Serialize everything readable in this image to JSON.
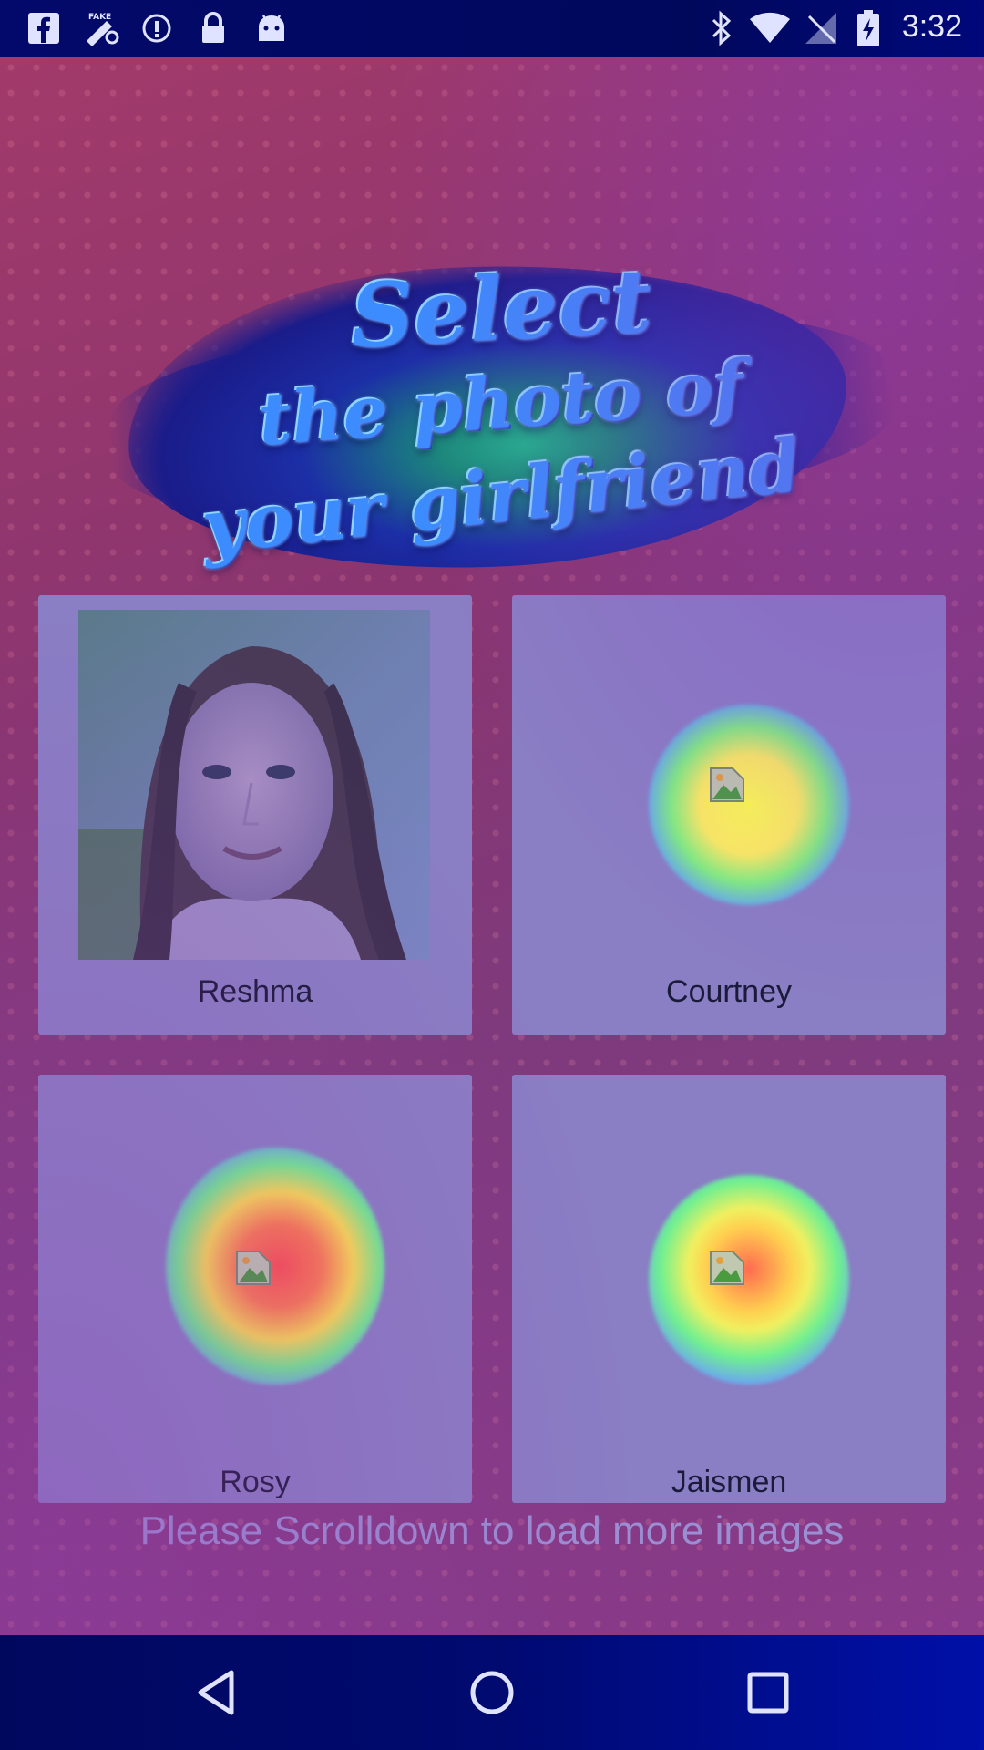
{
  "status_bar": {
    "time": "3:32",
    "left_icons": [
      "facebook-icon",
      "fake-gps-icon",
      "info-icon",
      "lock-icon",
      "android-icon"
    ],
    "right_icons": [
      "bluetooth-icon",
      "wifi-icon",
      "no-signal-icon",
      "battery-charging-icon"
    ]
  },
  "banner": {
    "line1": "Select",
    "line2": "the photo of",
    "line3": "your girlfriend"
  },
  "cards": [
    {
      "name": "Reshma",
      "has_photo": true
    },
    {
      "name": "Courtney",
      "has_photo": false
    },
    {
      "name": "Rosy",
      "has_photo": false
    },
    {
      "name": "Jaismen",
      "has_photo": false
    }
  ],
  "scroll_hint": "Please Scrolldown to load more images",
  "nav_bar": {
    "buttons": [
      "back-icon",
      "home-icon",
      "recents-icon"
    ]
  },
  "colors": {
    "card_background": "#8a7ec4",
    "title_blue": "#3c8cff",
    "nav_bar": "#000a70"
  }
}
